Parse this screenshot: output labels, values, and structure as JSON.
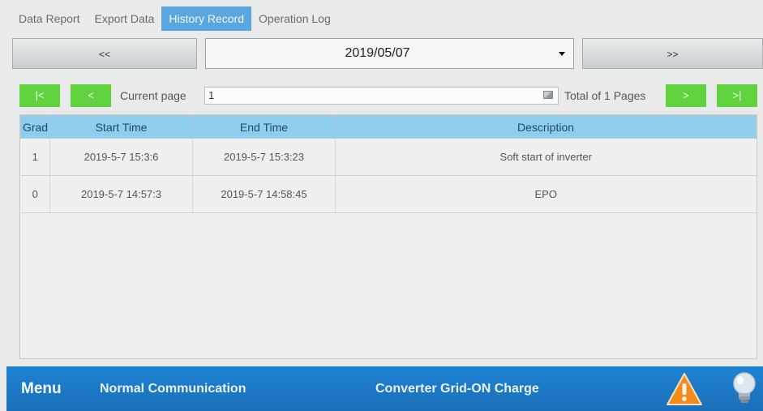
{
  "tabs": [
    {
      "label": "Data Report",
      "active": false
    },
    {
      "label": "Export Data",
      "active": false
    },
    {
      "label": "History Record",
      "active": true
    },
    {
      "label": "Operation Log",
      "active": false
    }
  ],
  "date_nav": {
    "prev_label": "<<",
    "next_label": ">>",
    "selected_date": "2019/05/07"
  },
  "pager": {
    "first_label": "|<",
    "prev_label": "<",
    "current_page_label": "Current page",
    "current_page_value": "1",
    "total_label": "Total of 1 Pages",
    "next_label": ">",
    "last_label": ">|"
  },
  "table": {
    "columns": [
      "Grad",
      "Start Time",
      "End Time",
      "Description"
    ],
    "rows": [
      {
        "grad": "1",
        "start": "2019-5-7 15:3:6",
        "end": "2019-5-7 15:3:23",
        "description": "Soft start of inverter"
      },
      {
        "grad": "0",
        "start": "2019-5-7 14:57:3",
        "end": "2019-5-7 14:58:45",
        "description": "EPO"
      }
    ]
  },
  "statusbar": {
    "menu_label": "Menu",
    "communication": "Normal Communication",
    "mode": "Converter Grid-ON Charge",
    "warning_icon": "warning-triangle-icon",
    "light_icon": "light-bulb-icon"
  },
  "colors": {
    "active_tab": "#5aa7df",
    "pager_button": "#5fd23e",
    "table_header": "#8fcdee",
    "status_bar": "#1e83d4",
    "warning": "#f28a1e"
  }
}
